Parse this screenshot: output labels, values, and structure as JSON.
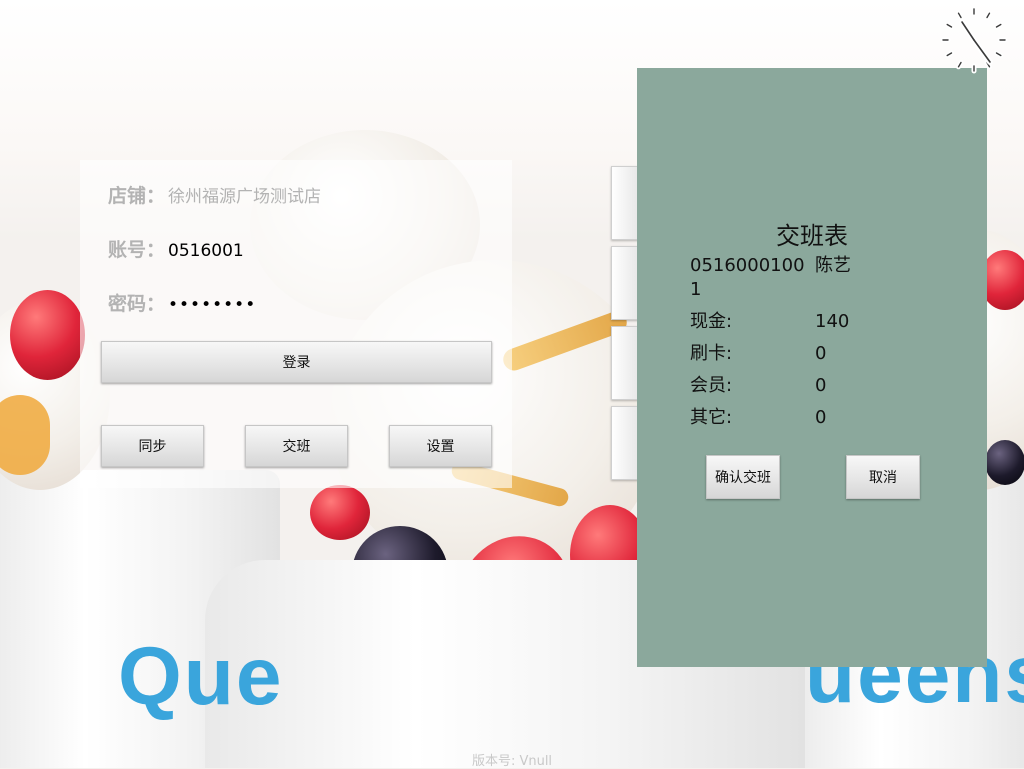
{
  "login": {
    "store_label": "店铺：",
    "store_value": "徐州福源广场测试店",
    "account_label": "账号：",
    "account_value": "0516001",
    "password_label": "密码：",
    "password_value": "••••••••",
    "login_button": "登录",
    "sync_button": "同步",
    "shift_button": "交班",
    "settings_button": "设置"
  },
  "shift_dialog": {
    "title": "交班表",
    "employee_id": "0516000100\n1",
    "employee_name": "陈艺",
    "rows": [
      {
        "label": "现金:",
        "value": "140"
      },
      {
        "label": "刷卡:",
        "value": "0"
      },
      {
        "label": "会员:",
        "value": "0"
      },
      {
        "label": "其它:",
        "value": "0"
      }
    ],
    "confirm_button": "确认交班",
    "cancel_button": "取消"
  },
  "background": {
    "brand_left": "Que",
    "brand_right": "ueens"
  },
  "footer": {
    "version": "版本号: Vnull"
  },
  "colors": {
    "dialog_bg": "#8ba89c",
    "brand_blue": "#3aa5dc"
  },
  "icons": {
    "clock": "clock-icon"
  }
}
